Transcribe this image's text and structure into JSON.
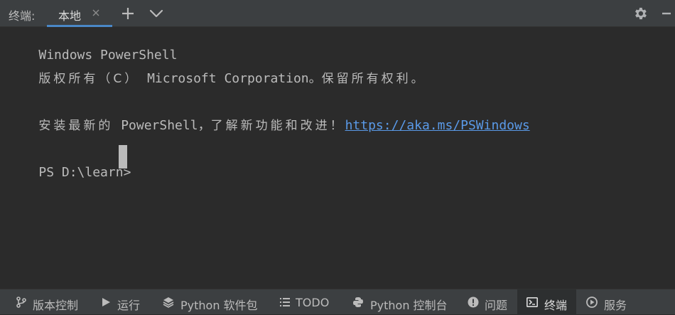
{
  "topbar": {
    "title": "终端:",
    "tab_label": "本地",
    "accent": "#4a88c7",
    "icons": [
      "close-icon",
      "plus-icon",
      "chevron-down-icon",
      "gear-icon",
      "minimize-icon"
    ]
  },
  "terminal": {
    "line1": "Windows PowerShell",
    "line2_cjk": "版权所有（C）",
    "line2_text": " Microsoft Corporation。",
    "line2_tail": "保留所有权利。",
    "line3_cjk_a": "安装最新的",
    "line3_text": " PowerShell，",
    "line3_cjk_b": "了解新功能和改进！",
    "line3_link": "https://aka.ms/PSWindows",
    "prompt": "PS D:\\learn>",
    "link_color": "#5a9ae8"
  },
  "bottombar": {
    "items": [
      {
        "label": "版本控制",
        "icon": "branch-icon"
      },
      {
        "label": "运行",
        "icon": "run-icon"
      },
      {
        "label": "Python 软件包",
        "icon": "layers-icon"
      },
      {
        "label": "TODO",
        "icon": "list-icon"
      },
      {
        "label": "Python 控制台",
        "icon": "python-icon"
      },
      {
        "label": "问题",
        "icon": "warning-icon"
      },
      {
        "label": "终端",
        "icon": "terminal-icon"
      },
      {
        "label": "服务",
        "icon": "services-icon"
      }
    ],
    "active": "终端"
  }
}
